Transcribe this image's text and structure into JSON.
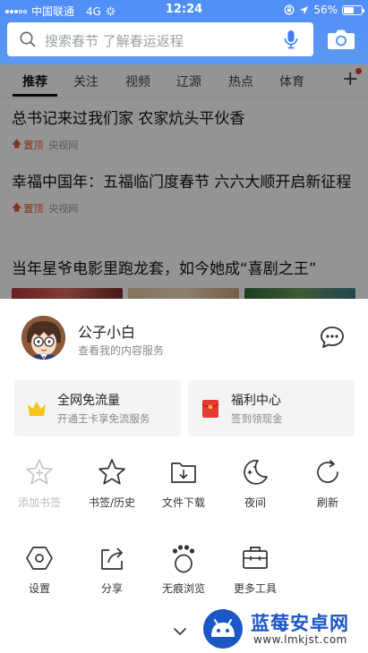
{
  "status_bar": {
    "carrier": "中国联通",
    "network": "4G",
    "time": "12:24",
    "battery_text": "56%",
    "battery_level": 0.56
  },
  "search": {
    "placeholder": "搜索春节 了解春运返程"
  },
  "tabs": [
    "推荐",
    "关注",
    "视频",
    "辽源",
    "热点",
    "体育"
  ],
  "tabs_active": "推荐",
  "articles": [
    {
      "title": "总书记来过我们家 农家炕头平伙香",
      "pin": "置顶",
      "source": "央视网"
    },
    {
      "title": "幸福中国年：五福临门度春节 六六大顺开启新征程",
      "pin": "置顶",
      "source": "央视网"
    },
    {
      "title": "当年星爷电影里跑龙套，如今她成“喜剧之王”"
    }
  ],
  "profile": {
    "name": "公子小白",
    "subtitle": "查看我的内容服务"
  },
  "cards": [
    {
      "title": "全网免流量",
      "subtitle": "开通王卡享免流服务",
      "icon": "crown-icon",
      "color": "#f5c518"
    },
    {
      "title": "福利中心",
      "subtitle": "签到领现金",
      "icon": "red-envelope-icon",
      "color": "#e53935"
    }
  ],
  "tools_row1": [
    {
      "label": "添加书签",
      "icon": "add-bookmark-icon",
      "disabled": true
    },
    {
      "label": "书签/历史",
      "icon": "star-icon",
      "disabled": false
    },
    {
      "label": "文件下载",
      "icon": "folder-download-icon",
      "disabled": false
    },
    {
      "label": "夜间",
      "icon": "moon-icon",
      "disabled": false
    },
    {
      "label": "刷新",
      "icon": "refresh-icon",
      "disabled": false
    }
  ],
  "tools_row2": [
    {
      "label": "设置",
      "icon": "settings-icon"
    },
    {
      "label": "分享",
      "icon": "share-icon"
    },
    {
      "label": "无痕浏览",
      "icon": "incognito-icon"
    },
    {
      "label": "更多工具",
      "icon": "toolbox-icon"
    }
  ],
  "watermark": {
    "name": "蓝莓安卓网",
    "url": "www.lmkjst.com"
  },
  "colors": {
    "topbar_blue": "#4f8ef7",
    "pin_red": "#e4572e",
    "watermark_blue": "#1b57c5"
  }
}
